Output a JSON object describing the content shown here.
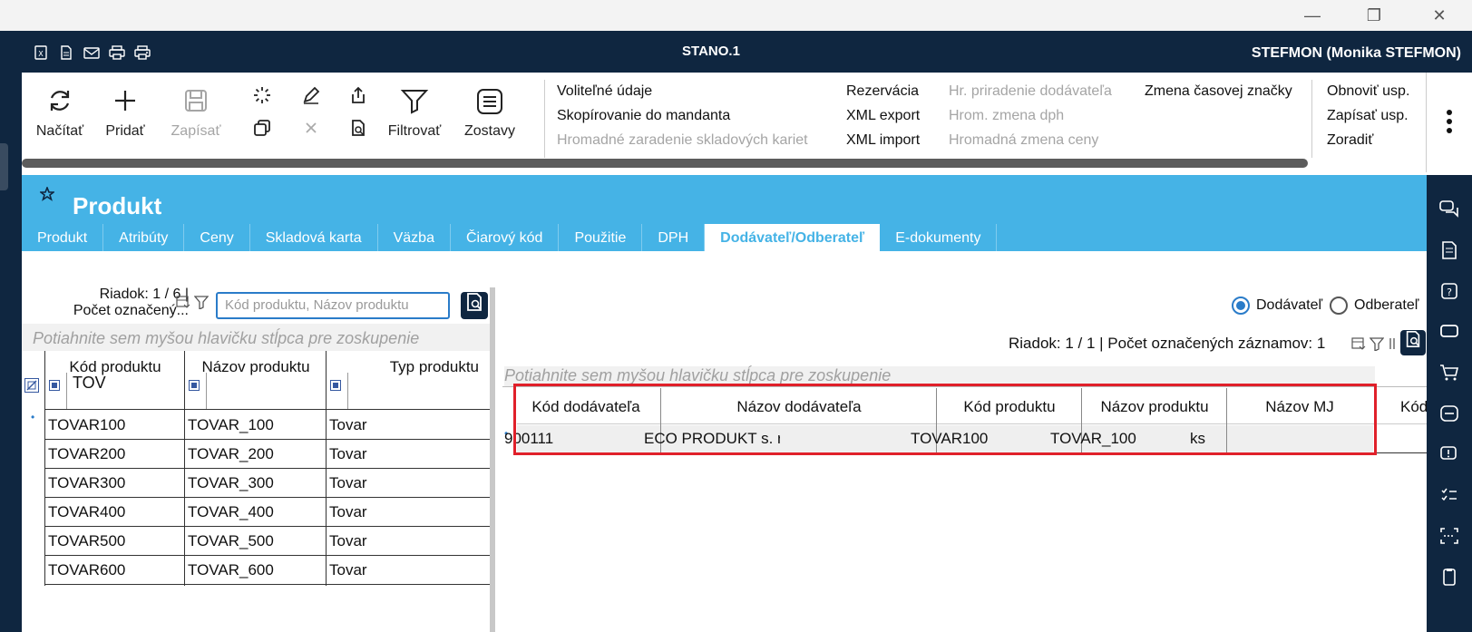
{
  "window": {
    "minimize_glyph": "—",
    "restore_glyph": "❐",
    "close_glyph": "✕"
  },
  "appbar": {
    "title": "STANO.1",
    "user": "STEFMON (Monika STEFMON)",
    "icons": [
      "excel-icon",
      "document-icon",
      "mail-icon",
      "print-icon",
      "print-preview-icon"
    ]
  },
  "toolbar": {
    "buttons": [
      {
        "label": "Načítať",
        "icon": "refresh-icon",
        "enabled": true
      },
      {
        "label": "Pridať",
        "icon": "plus-icon",
        "enabled": true
      },
      {
        "label": "Zapísať",
        "icon": "save-icon",
        "enabled": false
      }
    ],
    "filter_label": "Filtrovať",
    "reports_label": "Zostavy",
    "menu_col1": [
      {
        "label": "Voliteľné údaje",
        "enabled": true
      },
      {
        "label": "Skopírovanie do mandanta",
        "enabled": true
      },
      {
        "label": "Hromadné zaradenie skladových kariet",
        "enabled": false
      }
    ],
    "menu_col2": [
      {
        "label": "Rezervácia",
        "enabled": true
      },
      {
        "label": "XML export",
        "enabled": true
      },
      {
        "label": "XML import",
        "enabled": true
      }
    ],
    "menu_col3": [
      {
        "label": "Hr. priradenie dodávateľa",
        "enabled": false
      },
      {
        "label": "Hrom. zmena dph",
        "enabled": false
      },
      {
        "label": "Hromadná zmena ceny",
        "enabled": false
      }
    ],
    "menu_col4": [
      {
        "label": "Zmena časovej značky",
        "enabled": true
      }
    ],
    "menu_col5": [
      {
        "label": "Obnoviť usp.",
        "enabled": true
      },
      {
        "label": "Zapísať usp.",
        "enabled": true
      },
      {
        "label": "Zoradiť",
        "enabled": true
      }
    ]
  },
  "page": {
    "title": "Produkt"
  },
  "tabs": [
    {
      "label": "Produkt",
      "active": false
    },
    {
      "label": "Atribúty",
      "active": false
    },
    {
      "label": "Ceny",
      "active": false
    },
    {
      "label": "Skladová karta",
      "active": false
    },
    {
      "label": "Väzba",
      "active": false
    },
    {
      "label": "Čiarový kód",
      "active": false
    },
    {
      "label": "Použitie",
      "active": false
    },
    {
      "label": "DPH",
      "active": false
    },
    {
      "label": "Dodávateľ/Odberateľ",
      "active": true
    },
    {
      "label": "E-dokumenty",
      "active": false
    }
  ],
  "left": {
    "status_line1": "Riadok: 1 / 6 |",
    "status_line2": "Počet označený...",
    "search_placeholder": "Kód produktu, Názov produktu",
    "group_hint": "Potiahnite sem myšou hlavičku stĺpca pre zoskupenie",
    "columns": [
      "Kód produktu",
      "Názov produktu",
      "Typ produktu"
    ],
    "filter_value": "TOV",
    "rows": [
      [
        "TOVAR100",
        "TOVAR_100",
        "Tovar"
      ],
      [
        "TOVAR200",
        "TOVAR_200",
        "Tovar"
      ],
      [
        "TOVAR300",
        "TOVAR_300",
        "Tovar"
      ],
      [
        "TOVAR400",
        "TOVAR_400",
        "Tovar"
      ],
      [
        "TOVAR500",
        "TOVAR_500",
        "Tovar"
      ],
      [
        "TOVAR600",
        "TOVAR_600",
        "Tovar"
      ]
    ]
  },
  "right": {
    "radio_supplier": "Dodávateľ",
    "radio_customer": "Odberateľ",
    "selected": "Dodávateľ",
    "status": "Riadok: 1 / 1 | Počet označených záznamov: 1",
    "group_hint": "Potiahnite sem myšou hlavičku stĺpca pre zoskupenie",
    "columns": [
      "Kód dodávateľa",
      "Názov dodávateľa",
      "Kód produktu",
      "Názov produktu",
      "Názov MJ",
      "Kód"
    ],
    "rows": [
      [
        "900111",
        "ECO PRODUKT s. r. o.",
        "TOVAR100",
        "TOVAR_100",
        "ks",
        ""
      ]
    ]
  },
  "sidebar_icons": [
    "chat-icon",
    "document-list-icon",
    "help-icon",
    "message-icon",
    "cart-icon",
    "exchange-icon",
    "alert-icon",
    "checklist-icon",
    "scan-icon",
    "clipboard-icon"
  ]
}
